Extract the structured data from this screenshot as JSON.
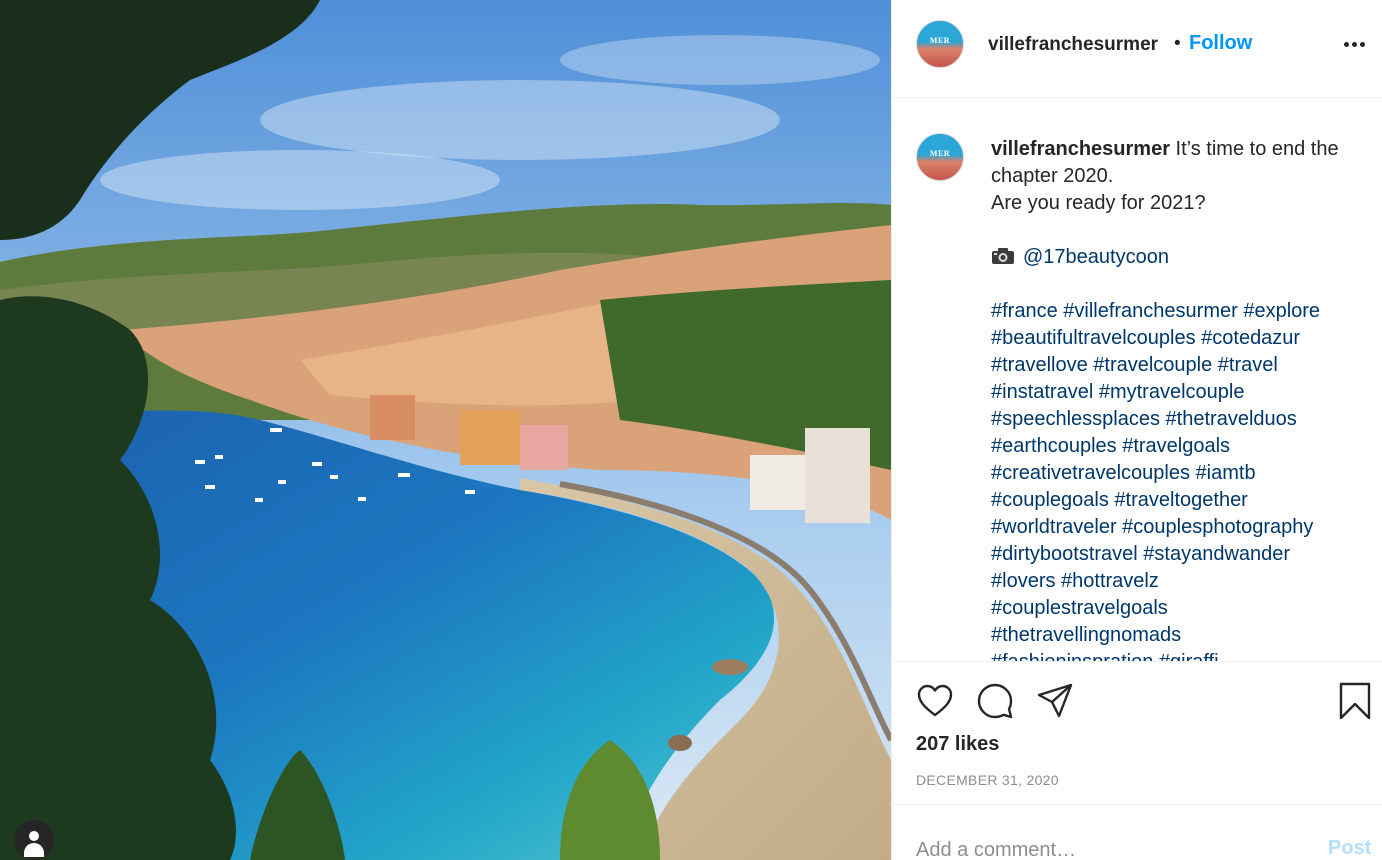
{
  "post": {
    "author": "villefranchesurmer",
    "avatar_text": "MER",
    "follow_label": "Follow",
    "separator": "•",
    "more_icon": "more-options-icon",
    "photo_icon": "user-tag-icon"
  },
  "caption": {
    "author": "villefranchesurmer",
    "lines": [
      "It’s time to end the",
      "chapter 2020.",
      "Are you ready for 2021?"
    ],
    "credit_icon": "camera-icon",
    "credit": "@17beautycoon",
    "hashtags": [
      "#france #villefranchesurmer #explore",
      "#beautifultravelcouples #cotedazur",
      "#travellove #travelcouple #travel",
      "#instatravel #mytravelcouple",
      "#speechlessplaces #thetravelduos",
      "#earthcouples #travelgoals",
      "#creativetravelcouples #iamtb",
      "#couplegoals #traveltogether",
      "#worldtraveler #couplesphotography",
      "#dirtybootstravel #stayandwander",
      "#lovers #hottravelz",
      "#couplestravelgoals",
      "#thetravellingnomads",
      "#fashioninspration #giraffi..."
    ]
  },
  "actions": {
    "like_icon": "heart-icon",
    "comment_icon": "comment-icon",
    "share_icon": "share-icon",
    "save_icon": "bookmark-icon"
  },
  "likes": "207 likes",
  "date": "DECEMBER 31, 2020",
  "comment": {
    "placeholder": "Add a comment…",
    "post_label": "Post"
  },
  "colors": {
    "accent": "#0095f6",
    "link": "#00376b",
    "muted": "#8e8e8e",
    "post_disabled": "#b2dffc"
  }
}
